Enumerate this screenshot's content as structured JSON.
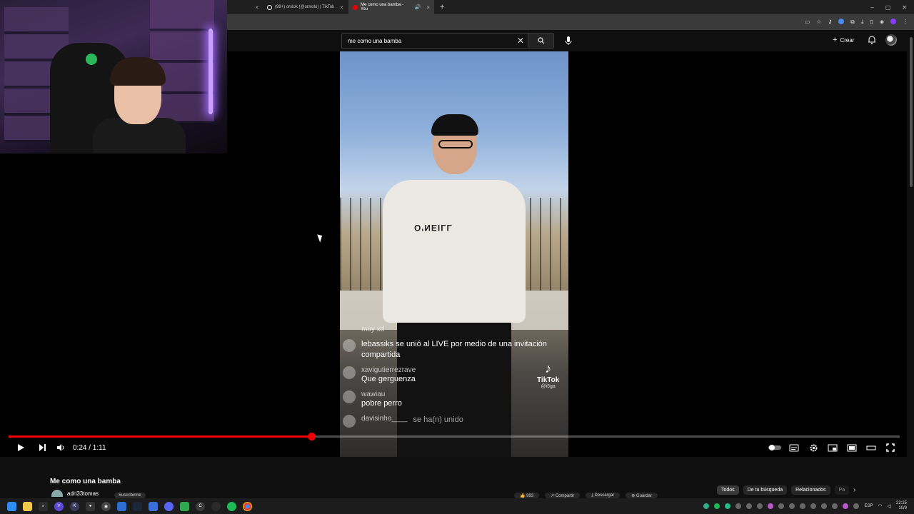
{
  "browser": {
    "tabs": [
      {
        "label": "",
        "active": false
      },
      {
        "label": "(99+) orslok (@orslolo) | TikTok",
        "active": false
      },
      {
        "label": "Me como una bamba - You",
        "active": true
      }
    ],
    "new_tab": "+",
    "win_minimize": "–",
    "win_maximize": "▢",
    "win_close": "✕"
  },
  "youtube": {
    "search": {
      "value": "me como una bamba"
    },
    "create_label": "Crear"
  },
  "video": {
    "chat": [
      {
        "user": "",
        "message": "muy xd"
      },
      {
        "user": "",
        "message": "lebassiks se unió al LIVE por medio de una invitación compartida"
      },
      {
        "user": "xavigutierrezrave",
        "message": "Que gerguenza"
      },
      {
        "user": "wawiau",
        "message": "pobre perro"
      },
      {
        "user": "davisinho____",
        "message": "se ha(n) unido"
      }
    ],
    "watermark_brand": "TikTok",
    "watermark_handle": "@i5ga",
    "shirt_logo": "O'NEILL"
  },
  "player": {
    "progress_fraction": 0.34,
    "time": "0:24 / 1:11"
  },
  "below": {
    "title": "Me como una bamba",
    "channel": "adri33tomas",
    "subscribe_label": "Suscribirme",
    "actions": [
      "👍 993",
      "↗ Compartir",
      "⤓ Descargar",
      "⊕ Guardar"
    ],
    "chips": [
      "Todos",
      "De tu búsqueda",
      "Relacionados",
      "Pa"
    ]
  },
  "taskbar": {
    "lang": "ESP",
    "time": "22:25",
    "date": "10/9"
  },
  "colors": {
    "accent": "#ff0000",
    "bg": "#0f0f0f"
  }
}
